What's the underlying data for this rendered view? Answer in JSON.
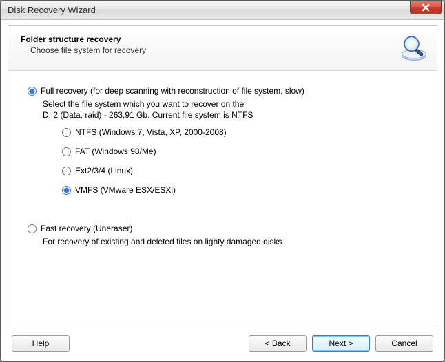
{
  "window": {
    "title": "Disk Recovery Wizard"
  },
  "header": {
    "title": "Folder structure recovery",
    "sub": "Choose file system for recovery"
  },
  "full": {
    "label": "Full recovery (for deep scanning with reconstruction of file system, slow)",
    "desc_l1": "Select the file system which you want to recover on the",
    "desc_l2": "D: 2 (Data, raid) - 263,91 Gb. Current file system is NTFS",
    "fs": {
      "ntfs": "NTFS (Windows 7, Vista, XP, 2000-2008)",
      "fat": "FAT (Windows 98/Me)",
      "ext": "Ext2/3/4 (Linux)",
      "vmfs": "VMFS (VMware ESX/ESXi)"
    }
  },
  "fast": {
    "label": "Fast recovery (Uneraser)",
    "desc": "For recovery of existing and deleted files on lighty damaged disks"
  },
  "buttons": {
    "help": "Help",
    "back": "< Back",
    "next": "Next >",
    "cancel": "Cancel"
  }
}
